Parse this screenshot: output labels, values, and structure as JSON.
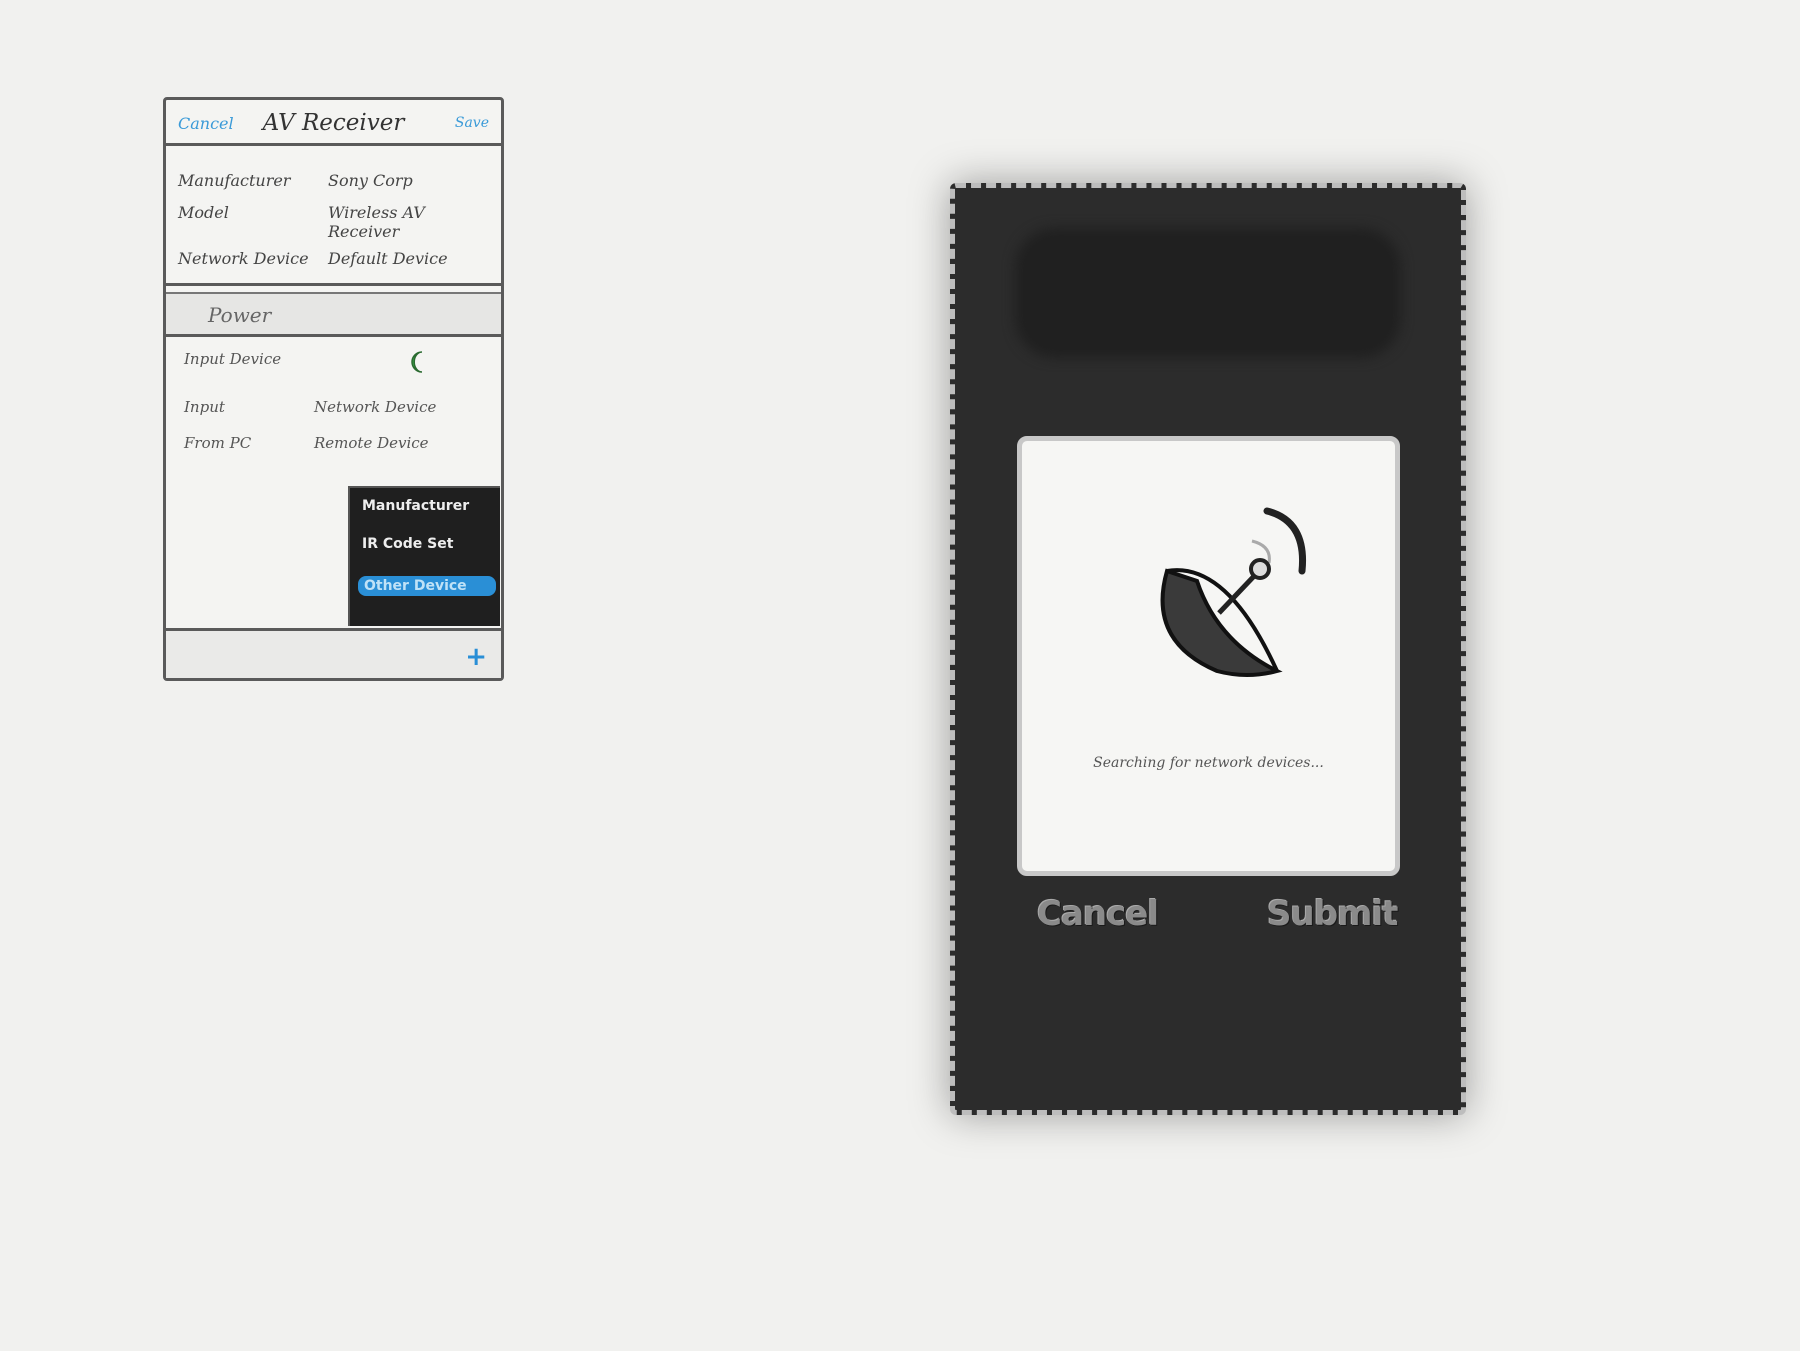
{
  "left_screen": {
    "nav": {
      "cancel_label": "Cancel",
      "title": "AV Receiver",
      "save_label": "Save"
    },
    "info_rows": [
      {
        "label": "Manufacturer",
        "value": "Sony Corp"
      },
      {
        "label": "Model",
        "value": "Wireless AV Receiver"
      },
      {
        "label": "Network Device",
        "value": "Default Device"
      }
    ],
    "section_header": "Power",
    "list_rows": [
      {
        "label": "Input Device",
        "value": ""
      },
      {
        "label": "Input",
        "value": "Network Device"
      },
      {
        "label": "From PC",
        "value": "Remote Device"
      }
    ],
    "toggle_on": true,
    "popup_options": [
      {
        "label": "Manufacturer",
        "selected": false
      },
      {
        "label": "IR Code Set",
        "selected": false
      },
      {
        "label": "Other Device",
        "selected": true
      }
    ],
    "add_icon": "plus-icon",
    "accent_color": "#2a8fd6"
  },
  "right_screen": {
    "status_text": "Searching for network devices...",
    "dish_icon": "satellite-dish-icon",
    "cancel_label": "Cancel",
    "submit_label": "Submit"
  }
}
